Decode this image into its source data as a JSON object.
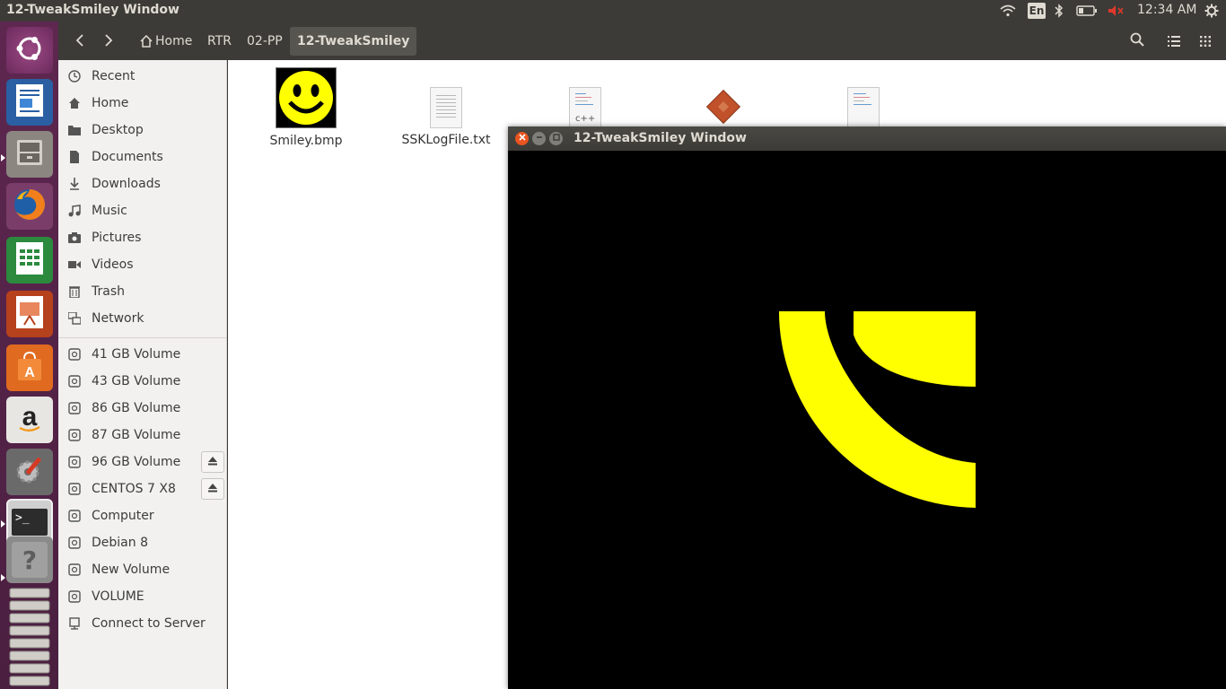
{
  "top_panel": {
    "window_title": "12-TweakSmiley Window",
    "keyboard_layout": "En",
    "clock": "12:34 AM"
  },
  "launcher": {
    "items": [
      {
        "name": "ubuntu-dash",
        "icon": "ubuntu-logo-icon"
      },
      {
        "name": "libreoffice-writer",
        "icon": "writer-icon"
      },
      {
        "name": "files",
        "icon": "file-cabinet-icon"
      },
      {
        "name": "firefox",
        "icon": "firefox-icon"
      },
      {
        "name": "libreoffice-calc",
        "icon": "calc-icon"
      },
      {
        "name": "libreoffice-impress",
        "icon": "impress-icon"
      },
      {
        "name": "software-center",
        "icon": "shopping-bag-icon"
      },
      {
        "name": "amazon",
        "icon": "amazon-icon"
      },
      {
        "name": "system-settings",
        "icon": "settings-icon"
      },
      {
        "name": "terminal",
        "icon": "terminal-icon"
      },
      {
        "name": "help",
        "icon": "question-icon"
      }
    ],
    "terminal_prompt": ">_",
    "help_glyph": "?"
  },
  "file_manager": {
    "breadcrumb": [
      "Home",
      "RTR",
      "02-PP",
      "12-TweakSmiley"
    ],
    "sidebar_places": [
      "Recent",
      "Home",
      "Desktop",
      "Documents",
      "Downloads",
      "Music",
      "Pictures",
      "Videos",
      "Trash",
      "Network"
    ],
    "sidebar_devices": [
      "41 GB Volume",
      "43 GB Volume",
      "86 GB Volume",
      "87 GB Volume",
      "96 GB Volume",
      "CENTOS 7 X8",
      "Computer",
      "Debian 8",
      "New Volume",
      "VOLUME",
      "Connect to Server"
    ],
    "files": [
      {
        "name": "Smiley.bmp",
        "type": "bmp-image"
      },
      {
        "name": "SSKLogFile.txt",
        "type": "text"
      },
      {
        "name": "",
        "type": "cpp-source",
        "badge": "c++"
      },
      {
        "name": "",
        "type": "executable"
      },
      {
        "name": "",
        "type": "text"
      }
    ]
  },
  "app_window": {
    "title": "12-TweakSmiley Window",
    "colors": {
      "background": "#000000",
      "shape": "#ffff00"
    }
  }
}
